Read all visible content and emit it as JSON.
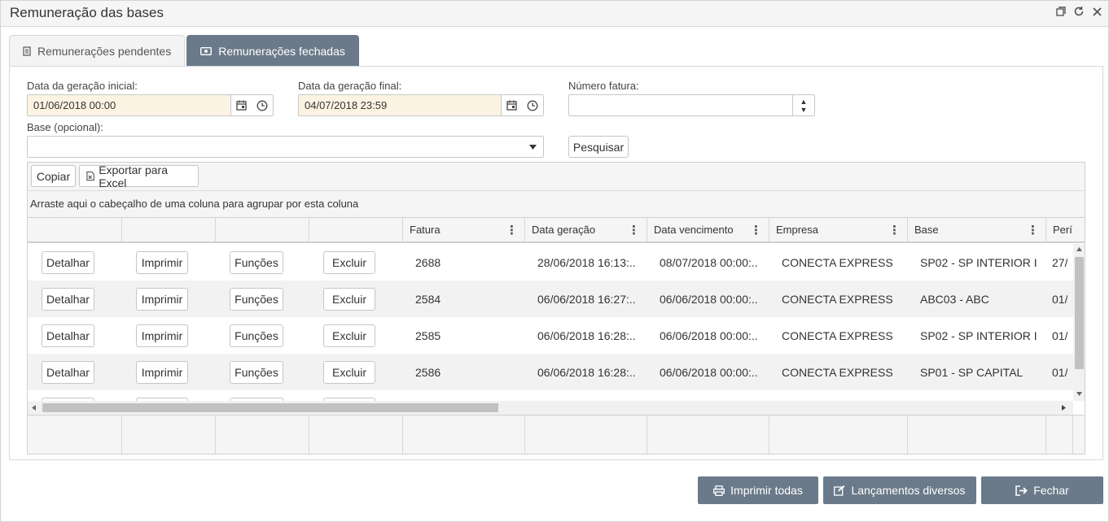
{
  "window": {
    "title": "Remuneração das bases"
  },
  "tabs": [
    {
      "label": "Remunerações pendentes",
      "active": false
    },
    {
      "label": "Remunerações fechadas",
      "active": true
    }
  ],
  "filters": {
    "start_date": {
      "label": "Data da geração inicial:",
      "value": "01/06/2018 00:00"
    },
    "end_date": {
      "label": "Data da geração final:",
      "value": "04/07/2018 23:59"
    },
    "invoice_number": {
      "label": "Número fatura:",
      "value": ""
    },
    "base": {
      "label": "Base (opcional):",
      "value": ""
    },
    "search_label": "Pesquisar"
  },
  "grid": {
    "toolbar": {
      "copy_label": "Copiar",
      "export_label": "Exportar para Excel"
    },
    "group_hint": "Arraste aqui o cabeçalho de uma coluna para agrupar por esta coluna",
    "columns": [
      "",
      "",
      "",
      "",
      "Fatura",
      "Data geração",
      "Data vencimento",
      "Empresa",
      "Base",
      "Perí"
    ],
    "row_actions": {
      "detail": "Detalhar",
      "print": "Imprimir",
      "functions": "Funções",
      "delete": "Excluir"
    },
    "rows": [
      {
        "fatura": "2688",
        "data_geracao": "28/06/2018 16:13:...",
        "data_vencimento": "08/07/2018 00:00:...",
        "empresa": "CONECTA EXPRESS",
        "base": "SP02 - SP INTERIOR I",
        "periodo": "27/"
      },
      {
        "fatura": "2584",
        "data_geracao": "06/06/2018 16:27:...",
        "data_vencimento": "06/06/2018 00:00:...",
        "empresa": "CONECTA EXPRESS",
        "base": "ABC03 - ABC",
        "periodo": "01/"
      },
      {
        "fatura": "2585",
        "data_geracao": "06/06/2018 16:28:...",
        "data_vencimento": "06/06/2018 00:00:...",
        "empresa": "CONECTA EXPRESS",
        "base": "SP02 - SP INTERIOR I",
        "periodo": "01/"
      },
      {
        "fatura": "2586",
        "data_geracao": "06/06/2018 16:28:...",
        "data_vencimento": "06/06/2018 00:00:...",
        "empresa": "CONECTA EXPRESS",
        "base": "SP01 - SP CAPITAL",
        "periodo": "01/"
      }
    ]
  },
  "footer": {
    "print_all_label": "Imprimir todas",
    "misc_entries_label": "Lançamentos diversos",
    "close_label": "Fechar"
  }
}
